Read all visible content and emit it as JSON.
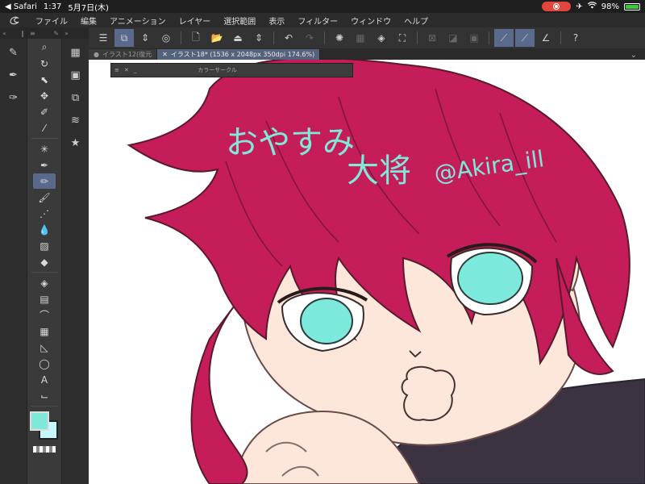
{
  "status": {
    "back_app": "◀ Safari",
    "time": "1:37",
    "date": "5月7日(木)",
    "battery_pct": "98%",
    "battery_level": 0.98,
    "record_color": "#e0463e"
  },
  "menu": {
    "items": [
      "ファイル",
      "編集",
      "アニメーション",
      "レイヤー",
      "選択範囲",
      "表示",
      "フィルター",
      "ウィンドウ",
      "ヘルプ"
    ]
  },
  "tabs": [
    {
      "label": "イラスト12(復元",
      "active": false
    },
    {
      "label": "イラスト18* (1536 x 2048px 350dpi 174.6%)",
      "active": true
    }
  ],
  "palette": {
    "title": "カラーサークル"
  },
  "canvas_text": {
    "line1": "おやすみ",
    "line2": "大将",
    "credit": "@Akira_ill"
  },
  "colors": {
    "accent": "#5a6a8c",
    "main_color": "#7fe8d8",
    "sub_color": "#c8f6ff",
    "hair": "#c81e5a",
    "skin": "#fce8dc",
    "eye": "#7de8dc"
  }
}
